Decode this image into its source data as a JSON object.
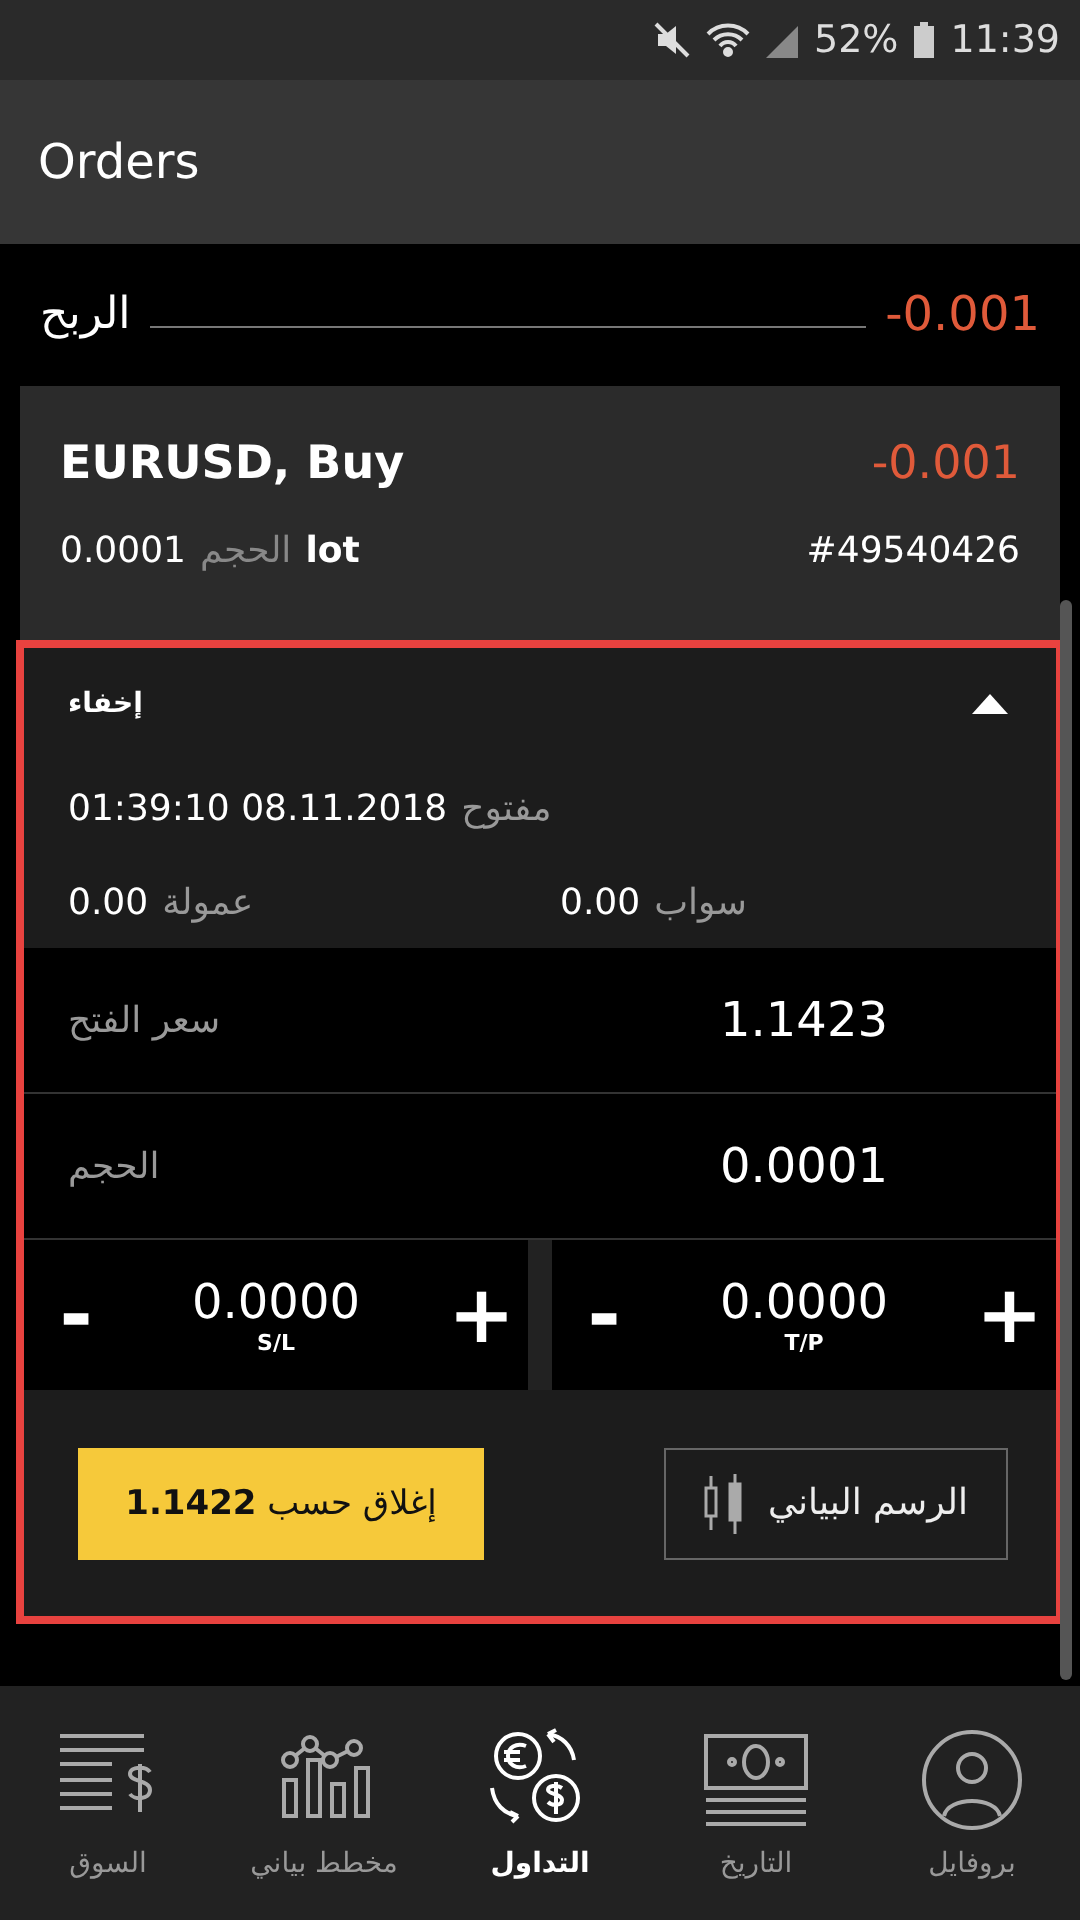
{
  "status_bar": {
    "battery": "52%",
    "time": "11:39"
  },
  "app_bar": {
    "title": "Orders"
  },
  "profit": {
    "label": "الربح",
    "value": "-0.001"
  },
  "order": {
    "symbol": "EURUSD, Buy",
    "profit": "-0.001",
    "volume": "0.0001",
    "volume_label": "الحجم",
    "unit": "lot",
    "ticket": "#49540426"
  },
  "details": {
    "expanded": true,
    "toggle": "إخفاء",
    "opened_label": "مفتوح",
    "opened": "01:39:10 08.11.2018",
    "commission_label": "عمولة",
    "commission": "0.00",
    "swap_label": "سواب",
    "swap": "0.00",
    "fields": [
      {
        "label": "سعر الفتح",
        "value": "1.1423"
      },
      {
        "label": "الحجم",
        "value": "0.0001"
      }
    ],
    "steppers": [
      {
        "minus": "-",
        "value": "0.0000",
        "plus": "+",
        "caption": "T/P"
      },
      {
        "minus": "-",
        "value": "0.0000",
        "plus": "+",
        "caption": "S/L"
      }
    ],
    "close_button": "إغلاق حسب **1.1422**",
    "chart_button": "الرسم البياني"
  },
  "tabs": [
    {
      "kind": "profile",
      "label": "بروفايل",
      "selected": false
    },
    {
      "kind": "history",
      "label": "التاريخ",
      "selected": false
    },
    {
      "kind": "trade",
      "label": "التداول",
      "selected": true
    },
    {
      "kind": "chart",
      "label": "مخطط بياني",
      "selected": false
    },
    {
      "kind": "market",
      "label": "السوق",
      "selected": false
    }
  ]
}
